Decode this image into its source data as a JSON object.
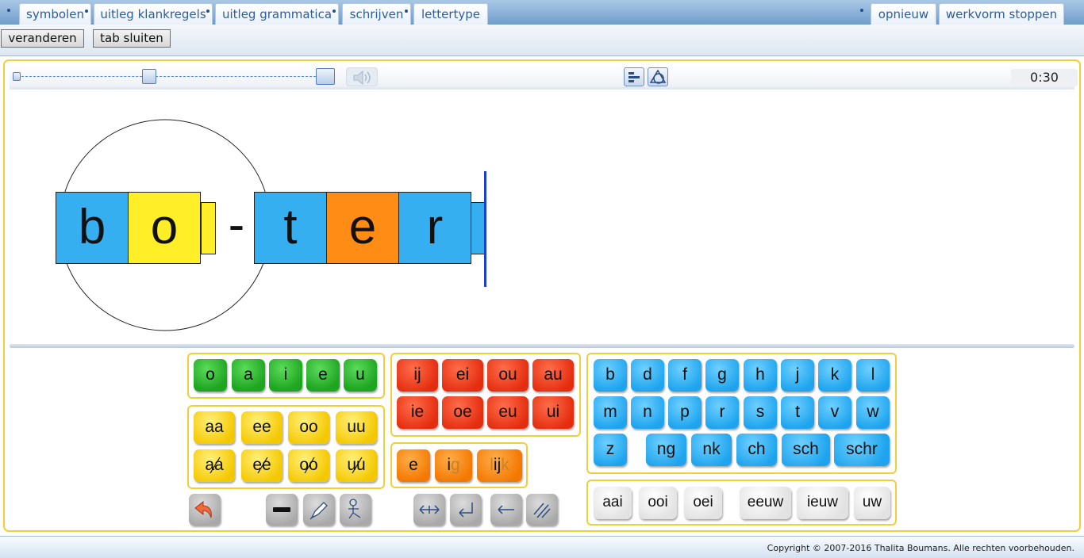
{
  "tabs": [
    {
      "label": "symbolen",
      "dot": true
    },
    {
      "label": "uitleg klankregels",
      "dot": true
    },
    {
      "label": "uitleg grammatica",
      "dot": true
    },
    {
      "label": "schrijven",
      "dot": true
    },
    {
      "label": "lettertype",
      "dot": false
    }
  ],
  "right_tabs": [
    {
      "label": "opnieuw"
    },
    {
      "label": "werkvorm stoppen"
    }
  ],
  "subbar": {
    "change_label": "veranderen",
    "close_label": "tab sluiten"
  },
  "toolbar": {
    "timer": "0:30",
    "speed_level": 0.43
  },
  "word": {
    "letters": [
      "b",
      "o",
      "-",
      "t",
      "e",
      "r"
    ],
    "colors": {
      "blue": "#36aff0",
      "yellow": "#ffee28",
      "orange": "#ff8c14"
    }
  },
  "keyboard": {
    "short_vowels": [
      "o",
      "a",
      "i",
      "e",
      "u"
    ],
    "long_vowels": [
      "aa",
      "ee",
      "oo",
      "uu"
    ],
    "long_vowels_struck": [
      "aa",
      "ee",
      "oo",
      "uu"
    ],
    "diphthongs_row1": [
      "ij",
      "ei",
      "ou",
      "au"
    ],
    "diphthongs_row2": [
      "ie",
      "oe",
      "eu",
      "ui"
    ],
    "schwa": {
      "e": "e",
      "i": "i",
      "g": "g",
      "l": "l",
      "ij": "ij",
      "k": "k"
    },
    "consonants_row1": [
      "b",
      "d",
      "f",
      "g",
      "h",
      "j",
      "k",
      "l"
    ],
    "consonants_row2": [
      "m",
      "n",
      "p",
      "r",
      "s",
      "t",
      "v",
      "w"
    ],
    "consonants_row3": [
      "z",
      "ng",
      "nk",
      "ch",
      "sch",
      "schr"
    ],
    "clusters": [
      "aai",
      "ooi",
      "oei",
      "eeuw",
      "ieuw",
      "uw"
    ]
  },
  "footer": {
    "copyright": "Copyright © 2007-2016 Thalita Boumans. Alle rechten voorbehouden."
  }
}
